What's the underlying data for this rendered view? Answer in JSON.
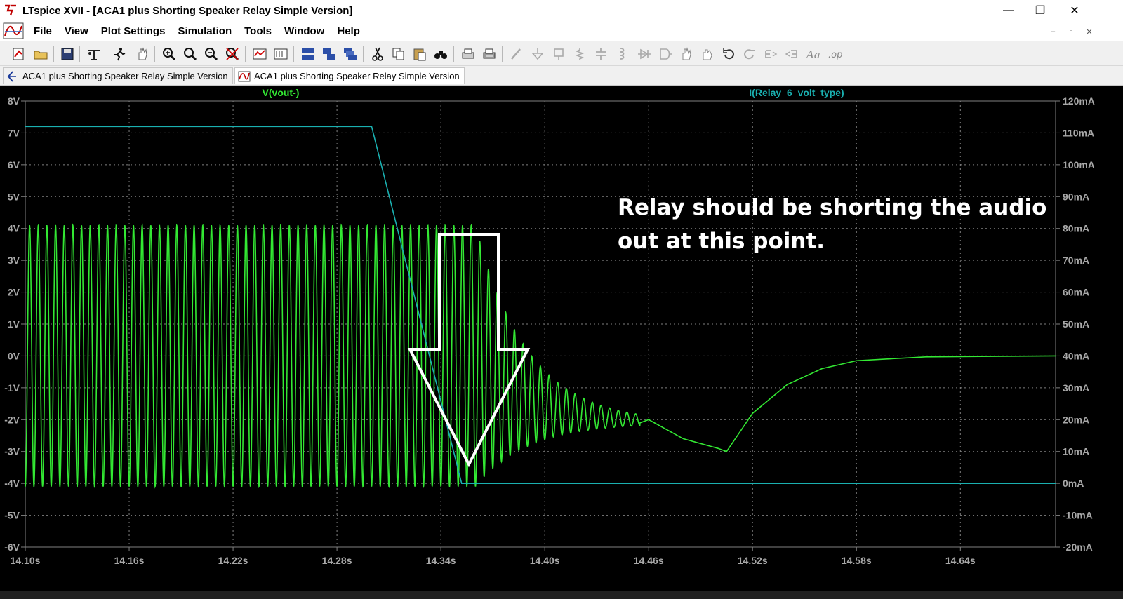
{
  "window": {
    "title": "LTspice XVII - [ACA1 plus Shorting Speaker Relay Simple Version]",
    "controls": {
      "minimize": "—",
      "restore": "❐",
      "close": "✕"
    }
  },
  "menu": {
    "items": [
      "File",
      "View",
      "Plot Settings",
      "Simulation",
      "Tools",
      "Window",
      "Help"
    ],
    "mdi_controls": {
      "minimize": "–",
      "restore": "▫",
      "close": "✕"
    }
  },
  "toolbar": {
    "buttons": [
      "new-schematic-icon",
      "open-folder-icon",
      "save-icon",
      "control-panel-icon",
      "run-icon",
      "halt-icon",
      "zoom-in-icon",
      "zoom-area-icon",
      "zoom-out-icon",
      "zoom-cancel-icon",
      "autorange-icon",
      "pick-visible-traces-icon",
      "tile-horizontal-icon",
      "tile-vertical-icon",
      "cascade-icon",
      "cut-icon",
      "copy-icon",
      "paste-icon",
      "find-icon",
      "print-icon",
      "print-setup-icon",
      "wire-icon",
      "ground-icon",
      "label-icon",
      "resistor-icon",
      "capacitor-icon",
      "inductor-icon",
      "diode-icon",
      "component-icon",
      "move-icon",
      "drag-icon",
      "undo-icon",
      "redo-icon",
      "rotate-icon",
      "mirror-icon",
      "text-icon",
      "spice-directive-icon"
    ]
  },
  "tabs": [
    {
      "label": "ACA1 plus Shorting Speaker Relay Simple Version",
      "kind": "schematic",
      "active": false
    },
    {
      "label": "ACA1 plus Shorting Speaker Relay Simple Version",
      "kind": "waveform",
      "active": true
    }
  ],
  "colors": {
    "plot_bg": "#000000",
    "grid": "#808080",
    "axis_text": "#a8a8a8",
    "voltage_trace": "#33e833",
    "current_trace": "#1ab0b0",
    "arrow": "#ffffff"
  },
  "annotation": {
    "line1": "Relay should be shorting the audio",
    "line2": "out at this point."
  },
  "chart_data": {
    "type": "line",
    "x": {
      "min": 14.1,
      "max": 14.695,
      "unit": "s",
      "ticks": [
        "14.10s",
        "14.16s",
        "14.22s",
        "14.28s",
        "14.34s",
        "14.40s",
        "14.46s",
        "14.52s",
        "14.58s",
        "14.64s"
      ],
      "tick_values": [
        14.1,
        14.16,
        14.22,
        14.28,
        14.34,
        14.4,
        14.46,
        14.52,
        14.58,
        14.64
      ]
    },
    "y_left": {
      "min": -6,
      "max": 8,
      "unit": "V",
      "ticks": [
        "8V",
        "7V",
        "6V",
        "5V",
        "4V",
        "3V",
        "2V",
        "1V",
        "0V",
        "-1V",
        "-2V",
        "-3V",
        "-4V",
        "-5V",
        "-6V"
      ]
    },
    "y_right": {
      "min": -20,
      "max": 120,
      "unit": "mA",
      "ticks": [
        "120mA",
        "110mA",
        "100mA",
        "90mA",
        "80mA",
        "70mA",
        "60mA",
        "50mA",
        "40mA",
        "30mA",
        "20mA",
        "10mA",
        "0mA",
        "-10mA",
        "-20mA"
      ]
    },
    "grid": true,
    "series": [
      {
        "name": "V(vout-)",
        "axis": "left",
        "kind": "sine_decay",
        "amplitude": 4.1,
        "frequency_hz": 200,
        "decay_start": 14.36,
        "decay_tau": 0.03,
        "ring_end": 14.455,
        "recovery": [
          [
            14.455,
            -2.1
          ],
          [
            14.46,
            -2.0
          ],
          [
            14.48,
            -2.6
          ],
          [
            14.5,
            -2.9
          ],
          [
            14.505,
            -3.0
          ],
          [
            14.52,
            -1.8
          ],
          [
            14.54,
            -0.9
          ],
          [
            14.56,
            -0.4
          ],
          [
            14.58,
            -0.15
          ],
          [
            14.62,
            -0.03
          ],
          [
            14.695,
            0.0
          ]
        ]
      },
      {
        "name": "I(Relay_6_volt_type)",
        "axis": "right",
        "kind": "piecewise",
        "points": [
          [
            14.1,
            112
          ],
          [
            14.3,
            112
          ],
          [
            14.352,
            0
          ],
          [
            14.695,
            0
          ]
        ]
      }
    ]
  }
}
